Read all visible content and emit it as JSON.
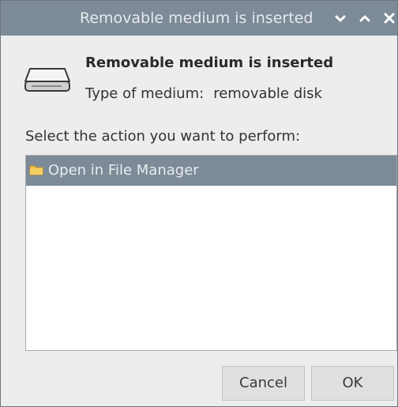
{
  "window": {
    "title": "Removable medium is inserted",
    "controls": {
      "minimize_icon": "chevron-down-icon",
      "maximize_icon": "chevron-up-icon",
      "close_icon": "close-icon"
    },
    "colors": {
      "titlebar": "#7d8a97",
      "selection": "#7d8a97",
      "folder": "#f2c14e"
    }
  },
  "header": {
    "icon": "drive-icon",
    "title": "Removable medium is inserted",
    "type_label": "Type of medium:",
    "type_value": "removable disk"
  },
  "prompt": "Select the action you want to perform:",
  "actions": {
    "items": [
      {
        "icon": "folder-icon",
        "label": "Open in File Manager",
        "selected": true
      }
    ]
  },
  "buttons": {
    "cancel": "Cancel",
    "ok": "OK"
  }
}
